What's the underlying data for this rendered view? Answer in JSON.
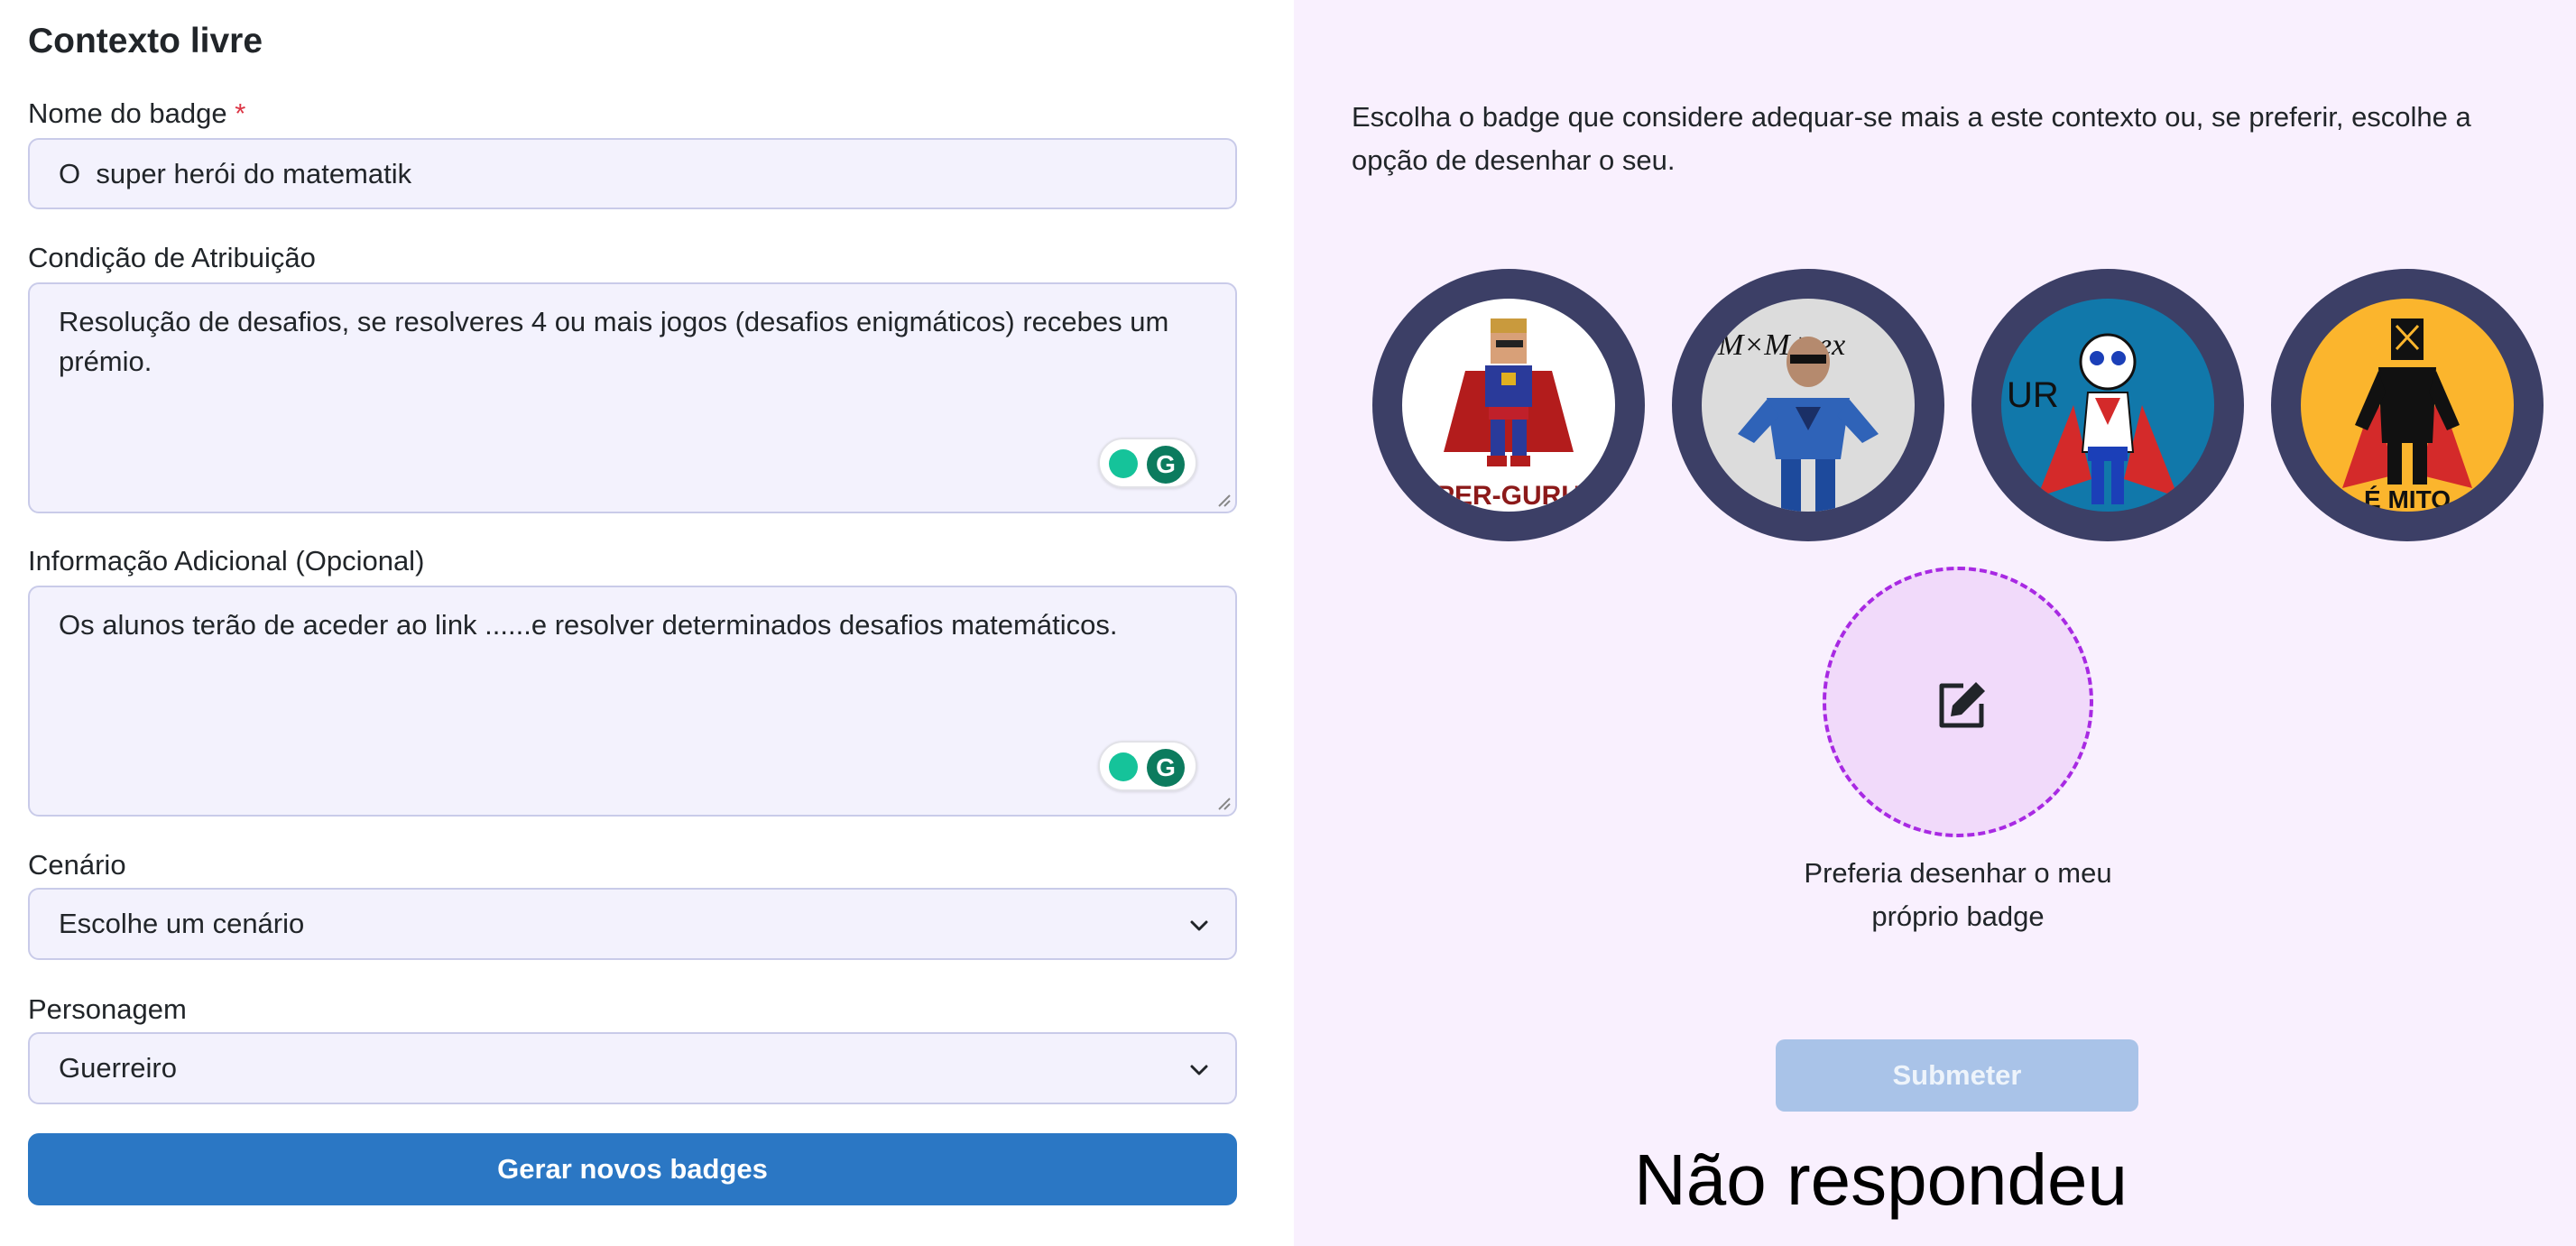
{
  "form": {
    "title": "Contexto livre",
    "badge_name": {
      "label": "Nome do badge",
      "required_mark": "*",
      "value": "O  super herói do matematik"
    },
    "condition": {
      "label": "Condição de Atribuição",
      "value": "Resolução de desafios, se resolveres 4 ou mais jogos (desafios enigmáticos) recebes um prémio."
    },
    "additional": {
      "label": "Informação Adicional (Opcional)",
      "value": "Os alunos terão de aceder ao link ......e resolver determinados desafios matemáticos."
    },
    "scenario": {
      "label": "Cenário",
      "value": "Escolhe um cenário"
    },
    "character": {
      "label": "Personagem",
      "value": "Guerreiro"
    },
    "generate_button": "Gerar novos badges",
    "grammarly_glyph": "G"
  },
  "panel": {
    "instruction": "Escolha o badge que considere adequar-se mais a este contexto ou, se preferir, escolhe a opção de desenhar o seu.",
    "badges": [
      {
        "name": "badge-pixel-hero",
        "text": "PER-GURU",
        "bg": "#ffffff"
      },
      {
        "name": "badge-math-hero",
        "text": "M×M+ ex",
        "bg": "#dcdcdc"
      },
      {
        "name": "badge-blue-hero",
        "text": "UR",
        "bg": "#1178aa"
      },
      {
        "name": "badge-black-hero",
        "text": "É MITO",
        "bg": "#fbb52d"
      }
    ],
    "draw_label": "Preferia desenhar o meu próprio badge",
    "submit_button": "Submeter"
  },
  "overlay_text": "Não respondeu",
  "colors": {
    "primary": "#2b77c4",
    "badge_ring": "#3c3f66",
    "panel_bg": "#f9f0fe",
    "draw_border": "#a829e3"
  }
}
